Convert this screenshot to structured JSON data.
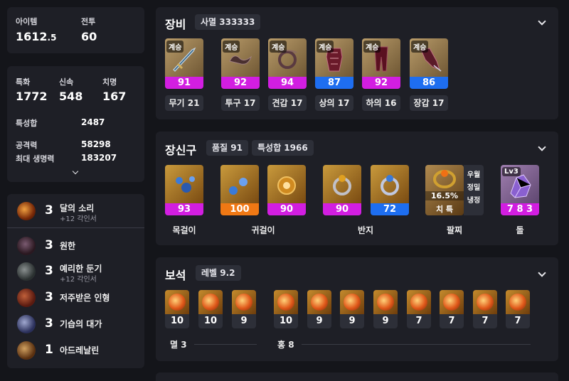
{
  "summary": {
    "item_label": "아이템",
    "item_level_main": "1612",
    "item_level_dec": ".5",
    "combat_label": "전투",
    "combat_level": "60"
  },
  "stats": {
    "crit_label": "특화",
    "crit_value": "1772",
    "swift_label": "신속",
    "swift_value": "548",
    "critical_label": "치명",
    "critical_value": "167",
    "total_label": "특성합",
    "total_value": "2487",
    "attack_label": "공격력",
    "attack_value": "58298",
    "hp_label": "최대 생명력",
    "hp_value": "183207"
  },
  "engravings": [
    {
      "level": "3",
      "name": "달의 소리",
      "sub": "+12 각인서",
      "icon": "moon-icon"
    },
    {
      "level": "3",
      "name": "원한",
      "sub": "",
      "icon": "grudge-icon"
    },
    {
      "level": "3",
      "name": "예리한 둔기",
      "sub": "+12 각인서",
      "icon": "keen-blunt-icon"
    },
    {
      "level": "3",
      "name": "저주받은 인형",
      "sub": "",
      "icon": "cursed-doll-icon"
    },
    {
      "level": "3",
      "name": "기습의 대가",
      "sub": "",
      "icon": "ambush-icon"
    },
    {
      "level": "1",
      "name": "아드레날린",
      "sub": "",
      "icon": "adrenaline-icon"
    }
  ],
  "equipment": {
    "title": "장비",
    "set_tag": "사멸 333333",
    "items": [
      {
        "tag": "계승",
        "quality": "91",
        "label": "무기 21",
        "color": "#d21ee1",
        "icon": "weapon-icon"
      },
      {
        "tag": "계승",
        "quality": "92",
        "label": "투구 17",
        "color": "#d21ee1",
        "icon": "helmet-icon"
      },
      {
        "tag": "계승",
        "quality": "94",
        "label": "견갑 17",
        "color": "#d21ee1",
        "icon": "shoulder-icon"
      },
      {
        "tag": "계승",
        "quality": "87",
        "label": "상의 17",
        "color": "#1e6ef0",
        "icon": "chest-icon"
      },
      {
        "tag": "계승",
        "quality": "92",
        "label": "하의 16",
        "color": "#d21ee1",
        "icon": "pants-icon"
      },
      {
        "tag": "계승",
        "quality": "86",
        "label": "장갑 17",
        "color": "#1e6ef0",
        "icon": "gloves-icon"
      }
    ]
  },
  "accessories": {
    "title": "장신구",
    "quality_tag": "품질 91",
    "stat_tag": "특성합 1966",
    "items": [
      {
        "quality": "93",
        "color": "#d21ee1",
        "icon": "necklace-icon"
      },
      {
        "quality": "100",
        "color": "#f07814",
        "icon": "earring-icon"
      },
      {
        "quality": "90",
        "color": "#d21ee1",
        "icon": "earring-icon"
      },
      {
        "quality": "90",
        "color": "#d21ee1",
        "icon": "ring-icon"
      },
      {
        "quality": "72",
        "color": "#1e6ef0",
        "icon": "ring-icon"
      }
    ],
    "bracelet": {
      "percent": "16.5%",
      "stats": "치 특",
      "side": "우월 정밀 냉정"
    },
    "stone": {
      "level": "Lv3",
      "value": "7 8 3"
    },
    "labels": {
      "necklace": "목걸이",
      "earring": "귀걸이",
      "ring": "반지",
      "bracelet": "팔찌",
      "stone": "돌"
    }
  },
  "gems": {
    "title": "보석",
    "level_tag": "레벨 9.2",
    "values": [
      "10",
      "10",
      "9",
      "10",
      "9",
      "9",
      "9",
      "7",
      "7",
      "7",
      "7"
    ],
    "group_a_label": "멸 3",
    "group_b_label": "홍 8"
  }
}
